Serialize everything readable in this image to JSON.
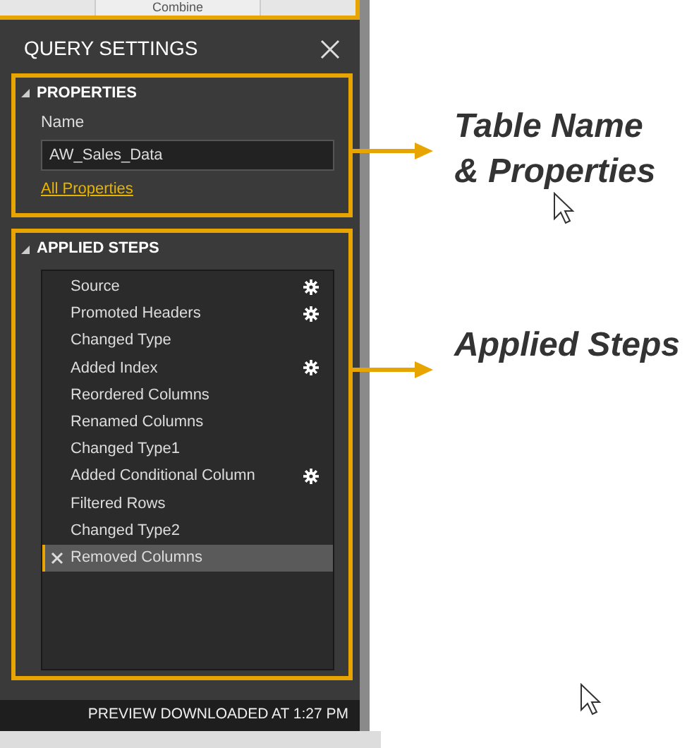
{
  "ribbon": {
    "button": "Combine"
  },
  "panel": {
    "title": "QUERY SETTINGS",
    "properties": {
      "heading": "PROPERTIES",
      "expanded": true,
      "name_label": "Name",
      "name_value": "AW_Sales_Data",
      "link": "All Properties"
    },
    "applied_steps": {
      "heading": "APPLIED STEPS",
      "expanded": true,
      "steps": [
        {
          "label": "Source",
          "settings": true,
          "selected": false
        },
        {
          "label": "Promoted Headers",
          "settings": true,
          "selected": false
        },
        {
          "label": "Changed Type",
          "settings": false,
          "selected": false
        },
        {
          "label": "Added Index",
          "settings": true,
          "selected": false
        },
        {
          "label": "Reordered Columns",
          "settings": false,
          "selected": false
        },
        {
          "label": "Renamed Columns",
          "settings": false,
          "selected": false
        },
        {
          "label": "Changed Type1",
          "settings": false,
          "selected": false
        },
        {
          "label": "Added Conditional Column",
          "settings": true,
          "selected": false
        },
        {
          "label": "Filtered Rows",
          "settings": false,
          "selected": false
        },
        {
          "label": "Changed Type2",
          "settings": false,
          "selected": false
        },
        {
          "label": "Removed Columns",
          "settings": false,
          "selected": true
        }
      ]
    },
    "status_bar": "PREVIEW DOWNLOADED AT 1:27 PM"
  },
  "callouts": [
    {
      "text": "Table Name\n& Properties"
    },
    {
      "text": "Applied Steps"
    }
  ]
}
